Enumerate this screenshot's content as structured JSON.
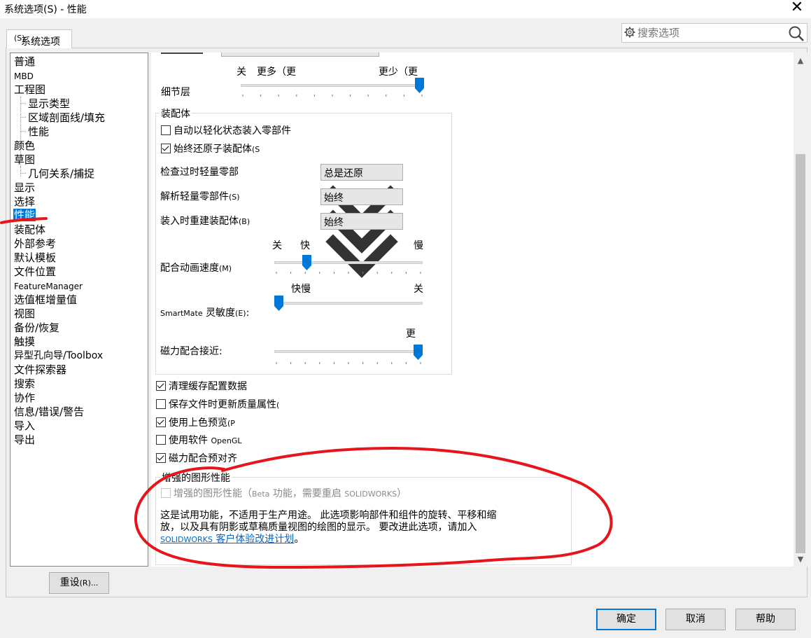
{
  "window": {
    "title": "系统选项(S) - 性能",
    "close_icon": "close-icon"
  },
  "tab": {
    "label": "系统选项",
    "shortcut": "(S)"
  },
  "search": {
    "placeholder": "搜索选项",
    "icon": "search-icon"
  },
  "tree": {
    "items": [
      {
        "label": "普通"
      },
      {
        "label": "MBD"
      },
      {
        "label": "工程图"
      },
      {
        "label": "显示类型"
      },
      {
        "label": "区域剖面线/填充"
      },
      {
        "label": "性能"
      },
      {
        "label": "颜色"
      },
      {
        "label": "草图"
      },
      {
        "label": "几何关系/捕捉"
      },
      {
        "label": "显示"
      },
      {
        "label": "选择"
      },
      {
        "label": "性能"
      },
      {
        "label": "装配体"
      },
      {
        "label": "外部参考"
      },
      {
        "label": "默认模板"
      },
      {
        "label": "文件位置"
      },
      {
        "label": "FeatureManager"
      },
      {
        "label": "选值框增量值"
      },
      {
        "label": "视图"
      },
      {
        "label": "备份/恢复"
      },
      {
        "label": "触摸"
      },
      {
        "label": "异型孔向导/Toolbox"
      },
      {
        "label": "文件探索器"
      },
      {
        "label": "搜索"
      },
      {
        "label": "协作"
      },
      {
        "label": "信息/错误/警告"
      },
      {
        "label": "导入"
      },
      {
        "label": "导出"
      }
    ],
    "selected_index": 11
  },
  "detail_level": {
    "label": "细节层",
    "left_label": "关",
    "more_label": "更多（更",
    "less_label": "更少（更",
    "value_fraction": 1.0
  },
  "assembly": {
    "title": "装配体",
    "auto_lightweight": {
      "label": "自动以轻化状态装入零部件",
      "checked": false
    },
    "always_resolve": {
      "label": "始终还原子装配体",
      "shortcut": "(S",
      "checked": true
    },
    "check_outdated": {
      "label": "检查过时轻量零部",
      "value": "总是还原"
    },
    "resolve_lightweight": {
      "label": "解析轻量零部件",
      "shortcut": "(S)",
      "value": "始终"
    },
    "rebuild_on_load": {
      "label": "装入时重建装配体",
      "shortcut": "(B)",
      "value": "始终"
    },
    "mate_anim": {
      "label": "配合动画速度",
      "shortcut": "(M)",
      "off": "关",
      "fast": "快",
      "slow": "慢",
      "value_fraction": 0.2
    },
    "smartmate": {
      "label_prefix": "SmartMate",
      "label": "灵敏度",
      "shortcut": "(E)",
      "suffix": ":",
      "fastslow": "快慢",
      "off": "关",
      "value_fraction": 0.0
    },
    "magnetic": {
      "label": "磁力配合接近:",
      "more": "更",
      "value_fraction": 1.0
    }
  },
  "options": [
    {
      "label": "清理缓存配置数据",
      "checked": true
    },
    {
      "label": "保存文件时更新质量属性",
      "shortcut": "(",
      "checked": false
    },
    {
      "label": "使用上色预览",
      "shortcut": "(P",
      "checked": true
    },
    {
      "label": "使用软件",
      "label_suffix": "OpenGL",
      "checked": false
    },
    {
      "label": "磁力配合预对齐",
      "checked": true
    }
  ],
  "enhanced": {
    "title": "增强的图形性能",
    "checkbox_label": "增强的图形性能（",
    "checkbox_beta": "Beta",
    "checkbox_label2": "功能，需要重启",
    "checkbox_sw": "SOLIDWORKS",
    "checkbox_end": "）",
    "checked": false,
    "desc_line1": "这是试用功能，不适用于生产用途。 此选项影响部件和组件的旋转、平移和缩",
    "desc_line2": "放，以及具有阴影或草稿质量视图的绘图的显示。 要改进此选项，请加入",
    "link_sw": "SOLIDWORKS",
    "link_text": "客户体验改进计划",
    "link_end": "。"
  },
  "buttons": {
    "reset": {
      "label": "重设",
      "shortcut": "(R)..."
    },
    "ok": "确定",
    "cancel": "取消",
    "help": "帮助"
  },
  "annotation_color": "#e8141c"
}
